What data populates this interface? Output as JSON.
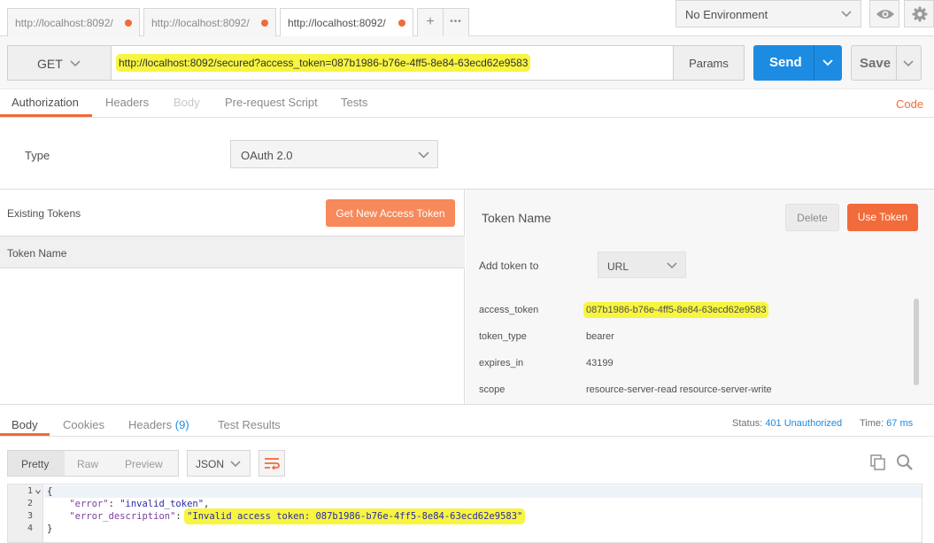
{
  "tabs": [
    {
      "title": "http://localhost:8092/",
      "active": false
    },
    {
      "title": "http://localhost:8092/",
      "active": false
    },
    {
      "title": "http://localhost:8092/",
      "active": true
    }
  ],
  "tab_actions": {
    "add": "+",
    "more": "•••"
  },
  "environment": {
    "selected": "No Environment"
  },
  "request": {
    "method": "GET",
    "url": "http://localhost:8092/secured?access_token=087b1986-b76e-4ff5-8e84-63ecd62e9583",
    "params_label": "Params",
    "send_label": "Send",
    "save_label": "Save"
  },
  "request_tabs": {
    "authorization": "Authorization",
    "headers": "Headers",
    "body": "Body",
    "prerequest": "Pre-request Script",
    "tests": "Tests",
    "code": "Code"
  },
  "auth": {
    "type_label": "Type",
    "type_value": "OAuth 2.0"
  },
  "tokens": {
    "existing_label": "Existing Tokens",
    "get_new_label": "Get New Access Token",
    "column_header": "Token Name"
  },
  "token_detail": {
    "title": "Token Name",
    "delete_label": "Delete",
    "use_label": "Use Token",
    "add_to_label": "Add token to",
    "add_to_value": "URL",
    "fields": [
      {
        "key": "access_token",
        "value": "087b1986-b76e-4ff5-8e84-63ecd62e9583"
      },
      {
        "key": "token_type",
        "value": "bearer"
      },
      {
        "key": "expires_in",
        "value": "43199"
      },
      {
        "key": "scope",
        "value": "resource-server-read resource-server-write"
      }
    ]
  },
  "response_tabs": {
    "body": "Body",
    "cookies": "Cookies",
    "headers": "Headers",
    "headers_count": "(9)",
    "tests": "Test Results"
  },
  "response_status": {
    "status_label": "Status:",
    "status_value": "401 Unauthorized",
    "time_label": "Time:",
    "time_value": "67 ms"
  },
  "response_view": {
    "modes": [
      "Pretty",
      "Raw",
      "Preview"
    ],
    "active_mode": "Pretty",
    "format": "JSON"
  },
  "response_body": {
    "line_numbers": [
      "1",
      "2",
      "3",
      "4"
    ],
    "open_brace": "{",
    "close_brace": "}",
    "error_key": "\"error\"",
    "error_value": "\"invalid_token\"",
    "desc_key": "\"error_description\"",
    "desc_value": "\"Invalid access token: 087b1986-b76e-4ff5-8e84-63ecd62e9583\""
  },
  "colors": {
    "accent_orange": "#f26b3a",
    "send_blue": "#1c8ce3",
    "highlight_yellow": "#f7f540"
  },
  "icons": [
    "close-dot-icon",
    "plus-icon",
    "more-icon",
    "chevron-down-icon",
    "eye-icon",
    "gear-icon",
    "wrap-icon",
    "copy-icon",
    "search-icon",
    "fold-arrow-icon"
  ]
}
